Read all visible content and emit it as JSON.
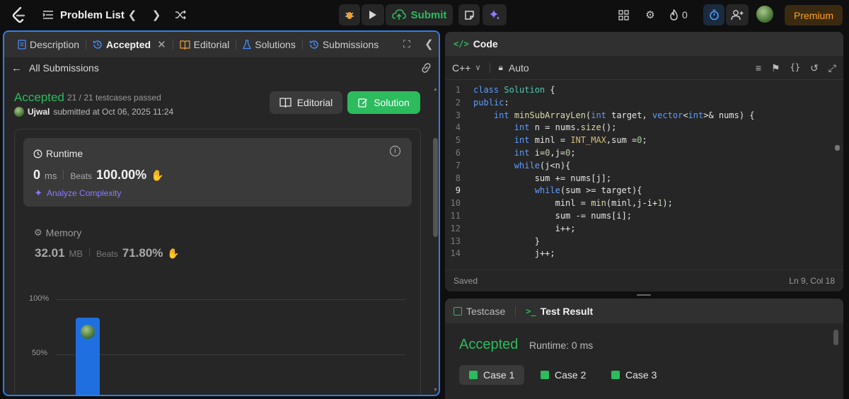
{
  "topbar": {
    "title": "Problem List",
    "submit_label": "Submit",
    "streak_count": "0",
    "premium_label": "Premium"
  },
  "left_panel": {
    "tabs": [
      {
        "label": "Description"
      },
      {
        "label": "Accepted"
      },
      {
        "label": "Editorial"
      },
      {
        "label": "Solutions"
      },
      {
        "label": "Submissions"
      }
    ],
    "back_label": "All Submissions",
    "status": "Accepted",
    "testcases": "21 / 21 testcases passed",
    "user": "Ujwal",
    "submitted_at": "submitted at Oct 06, 2025 11:24",
    "editorial_button": "Editorial",
    "solution_button": "Solution",
    "runtime": {
      "title": "Runtime",
      "value": "0",
      "unit": "ms",
      "beats_label": "Beats",
      "beats_value": "100.00%",
      "analyze_label": "Analyze Complexity"
    },
    "memory": {
      "title": "Memory",
      "value": "32.01",
      "unit": "MB",
      "beats_label": "Beats",
      "beats_value": "71.80%"
    },
    "chart": {
      "y_labels": [
        "100%",
        "50%"
      ]
    }
  },
  "code_panel": {
    "title": "Code",
    "language": "C++",
    "mode": "Auto",
    "status": "Saved",
    "cursor": "Ln 9, Col 18",
    "lines": [
      "class Solution {",
      "public:",
      "    int minSubArrayLen(int target, vector<int>& nums) {",
      "        int n = nums.size();",
      "        int minl = INT_MAX,sum =0;",
      "        int i=0,j=0;",
      "        while(j<n){",
      "            sum += nums[j];",
      "            while(sum >= target){",
      "                minl = min(minl,j-i+1);",
      "                sum -= nums[i];",
      "                i++;",
      "            }",
      "            j++;"
    ]
  },
  "result_panel": {
    "tab_testcase": "Testcase",
    "tab_result": "Test Result",
    "status": "Accepted",
    "runtime": "Runtime: 0 ms",
    "cases": [
      "Case 1",
      "Case 2",
      "Case 3"
    ]
  },
  "colors": {
    "accent_green": "#2cbb5d",
    "accent_blue": "#2f7ee8",
    "premium_orange": "#ffa116"
  }
}
